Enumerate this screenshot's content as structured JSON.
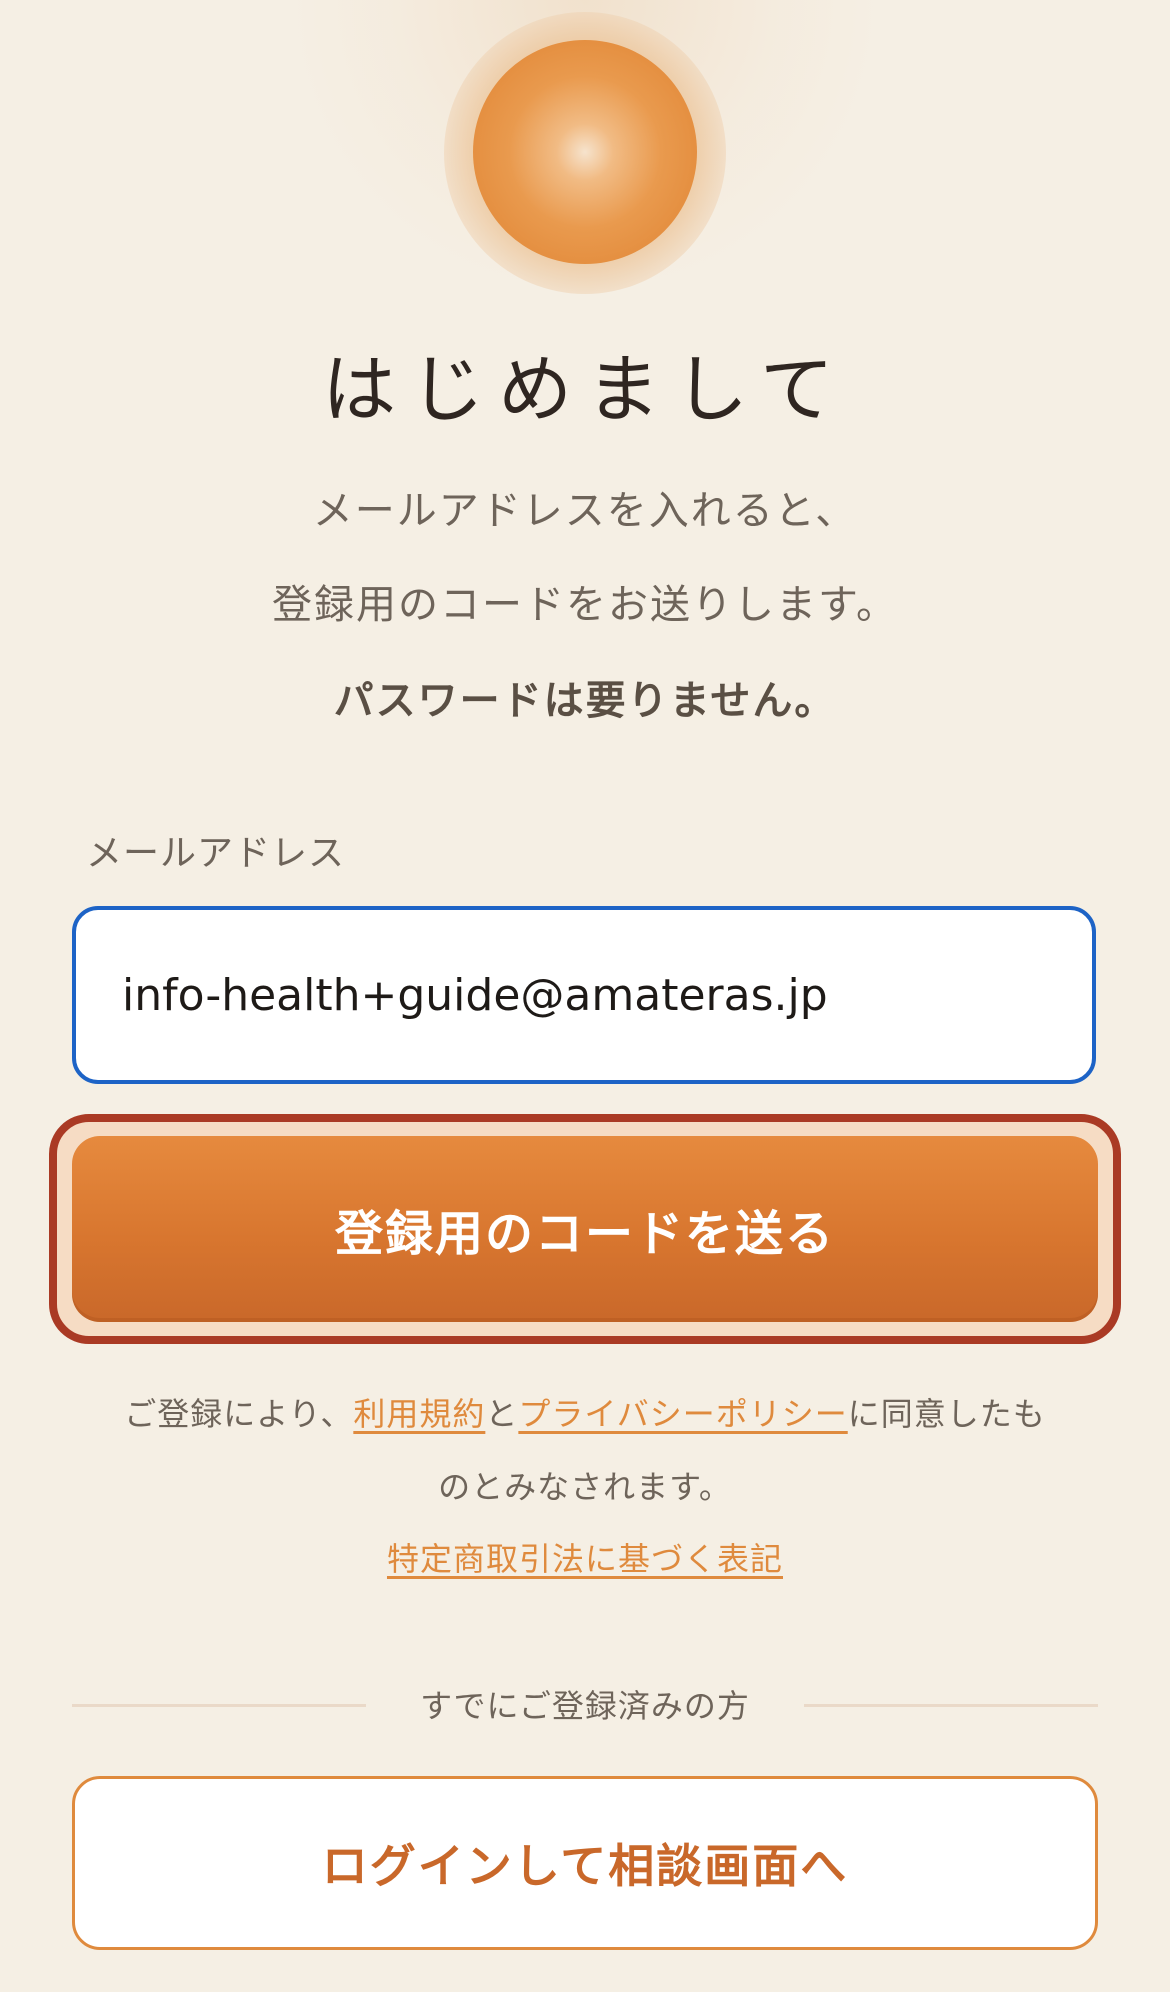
{
  "header": {
    "title": "はじめまして",
    "subtitle_line1": "メールアドレスを入れると、",
    "subtitle_line2": "登録用のコードをお送りします。",
    "subtitle_bold": "パスワードは要りません。"
  },
  "form": {
    "email_label": "メールアドレス",
    "email_value": "info-health+guide@amateras.jp",
    "submit_label": "登録用のコードを送る"
  },
  "terms": {
    "prefix": "ご登録により、",
    "terms_link": "利用規約",
    "and": "と",
    "privacy_link": "プライバシーポリシー",
    "suffix_line1": "に同意したも",
    "line2": "のとみなされます。",
    "commerce_link": "特定商取引法に基づく表記"
  },
  "existing": {
    "divider_text": "すでにご登録済みの方",
    "login_label": "ログインして相談画面へ"
  },
  "colors": {
    "accent": "#df8a3d",
    "button_top": "#e68a3e",
    "button_bottom": "#c9682a",
    "focus_border": "#1d63c6",
    "submit_ring": "#aa3a24",
    "background": "#f5efe4"
  },
  "icons": {
    "logo": "sun-icon"
  }
}
